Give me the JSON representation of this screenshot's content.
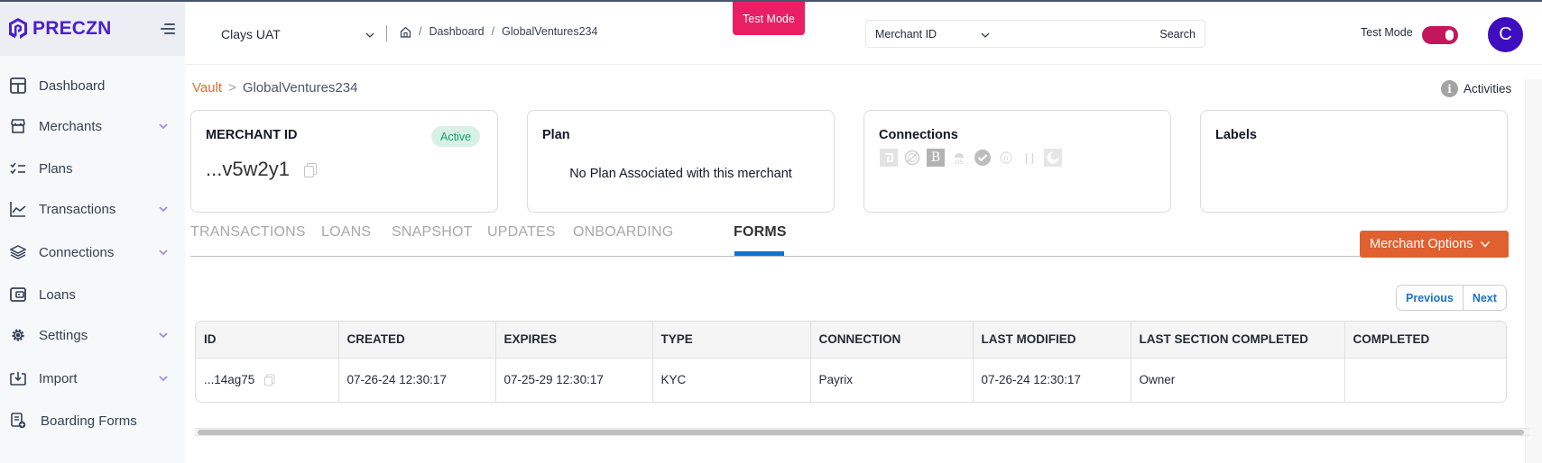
{
  "brand": {
    "name": "PRECZN",
    "color": "#4b1fd1"
  },
  "sidebar": {
    "items": [
      {
        "label": "Dashboard",
        "icon": "dashboard-icon",
        "has_submenu": false
      },
      {
        "label": "Merchants",
        "icon": "store-icon",
        "has_submenu": true
      },
      {
        "label": "Plans",
        "icon": "checklist-icon",
        "has_submenu": false
      },
      {
        "label": "Transactions",
        "icon": "chart-line-icon",
        "has_submenu": true
      },
      {
        "label": "Connections",
        "icon": "layers-icon",
        "has_submenu": true
      },
      {
        "label": "Loans",
        "icon": "wallet-icon",
        "has_submenu": false
      },
      {
        "label": "Settings",
        "icon": "gear-icon",
        "has_submenu": true
      },
      {
        "label": "Import",
        "icon": "import-icon",
        "has_submenu": true
      },
      {
        "label": "Boarding Forms",
        "icon": "form-add-icon",
        "has_submenu": false
      }
    ]
  },
  "header": {
    "environment": "Clays UAT",
    "breadcrumb": [
      "Dashboard",
      "GlobalVentures234"
    ],
    "test_mode_badge": "Test Mode",
    "search": {
      "select_value": "Merchant ID",
      "input_value": "",
      "button_label": "Search"
    },
    "test_mode_toggle": {
      "label": "Test Mode",
      "on": true,
      "color": "#c2185b"
    },
    "avatar_initial": "C"
  },
  "page": {
    "breadcrumb_root": "Vault",
    "breadcrumb_sep": ">",
    "breadcrumb_current": "GlobalVentures234",
    "activities_label": "Activities",
    "cards": {
      "merchant": {
        "title": "MERCHANT ID",
        "status": "Active",
        "id_value": "...v5w2y1"
      },
      "plan": {
        "title": "Plan",
        "message": "No Plan Associated with this merchant"
      },
      "connections": {
        "title": "Connections",
        "icons": [
          "connection-a-icon",
          "connection-globe-icon",
          "connection-b-icon",
          "connection-gs-icon",
          "connection-check-icon",
          "connection-n-icon",
          "connection-bracket-icon",
          "connection-moon-icon"
        ]
      },
      "labels": {
        "title": "Labels"
      }
    },
    "tabs": [
      {
        "label": "TRANSACTIONS",
        "active": false
      },
      {
        "label": "LOANS",
        "active": false
      },
      {
        "label": "SNAPSHOT",
        "active": false
      },
      {
        "label": "UPDATES",
        "active": false
      },
      {
        "label": "ONBOARDING",
        "active": false
      },
      {
        "label": "FORMS",
        "active": true
      }
    ],
    "merchant_options_label": "Merchant Options",
    "pager": {
      "previous": "Previous",
      "next": "Next"
    },
    "table": {
      "columns": [
        "ID",
        "CREATED",
        "EXPIRES",
        "TYPE",
        "CONNECTION",
        "LAST MODIFIED",
        "LAST SECTION COMPLETED",
        "COMPLETED"
      ],
      "rows": [
        [
          "...14ag75",
          "07-26-24 12:30:17",
          "07-25-29 12:30:17",
          "KYC",
          "Payrix",
          "07-26-24 12:30:17",
          "Owner",
          ""
        ]
      ]
    }
  },
  "colors": {
    "accent_orange": "#e06030",
    "test_mode_pink": "#e91e63",
    "tab_underline": "#0a73d4",
    "link_blue": "#1a73c8"
  }
}
